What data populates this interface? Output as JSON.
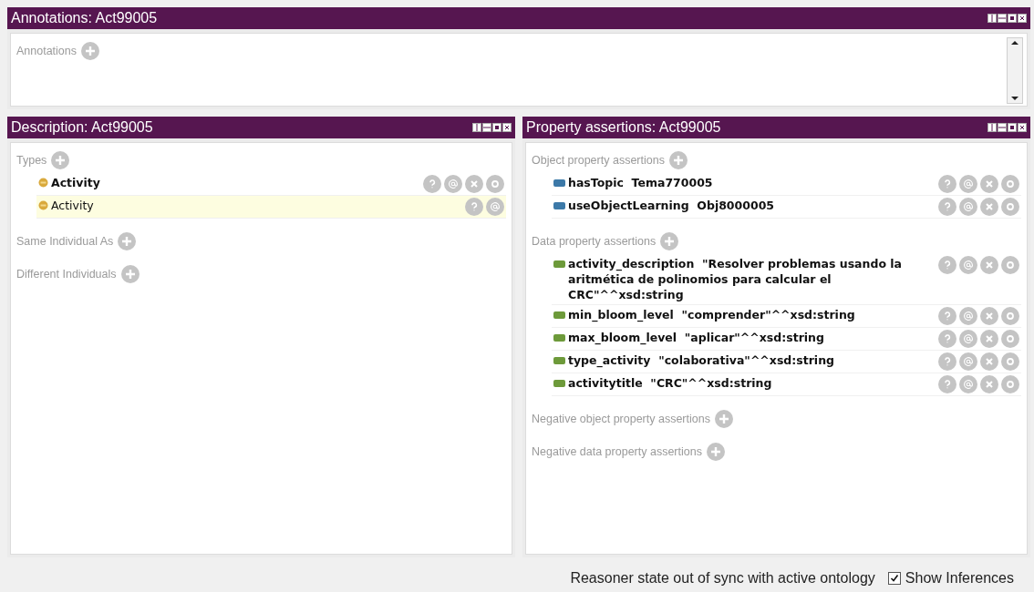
{
  "annotations_panel": {
    "title": "Annotations: Act99005",
    "sections": [
      {
        "label": "Annotations"
      }
    ]
  },
  "description_panel": {
    "title": "Description: Act99005",
    "sections": [
      {
        "label": "Types",
        "items": [
          {
            "kind": "class",
            "text": "Activity",
            "inferred": false
          },
          {
            "kind": "class",
            "text": "Activity",
            "inferred": true
          }
        ]
      },
      {
        "label": "Same Individual As"
      },
      {
        "label": "Different Individuals"
      }
    ]
  },
  "property_panel": {
    "title": "Property assertions: Act99005",
    "sections": [
      {
        "label": "Object property assertions",
        "items": [
          {
            "kind": "object",
            "text": "hasTopic  Tema770005",
            "inferred": false
          },
          {
            "kind": "object",
            "text": "useObjectLearning  Obj8000005",
            "inferred": false
          }
        ]
      },
      {
        "label": "Data property assertions",
        "items": [
          {
            "kind": "data",
            "text": "activity_description  \"Resolver problemas usando la aritmética de polinomios para calcular el CRC\"^^xsd:string",
            "inferred": false
          },
          {
            "kind": "data",
            "text": "min_bloom_level  \"comprender\"^^xsd:string",
            "inferred": false
          },
          {
            "kind": "data",
            "text": "max_bloom_level  \"aplicar\"^^xsd:string",
            "inferred": false
          },
          {
            "kind": "data",
            "text": "type_activity  \"colaborativa\"^^xsd:string",
            "inferred": false
          },
          {
            "kind": "data",
            "text": "activitytitle  \"CRC\"^^xsd:string",
            "inferred": false
          }
        ]
      },
      {
        "label": "Negative object property assertions"
      },
      {
        "label": "Negative data property assertions"
      }
    ]
  },
  "status_bar": {
    "message": "Reasoner state out of sync with active ontology",
    "show_inferences": {
      "label": "Show Inferences",
      "checked": true
    }
  }
}
